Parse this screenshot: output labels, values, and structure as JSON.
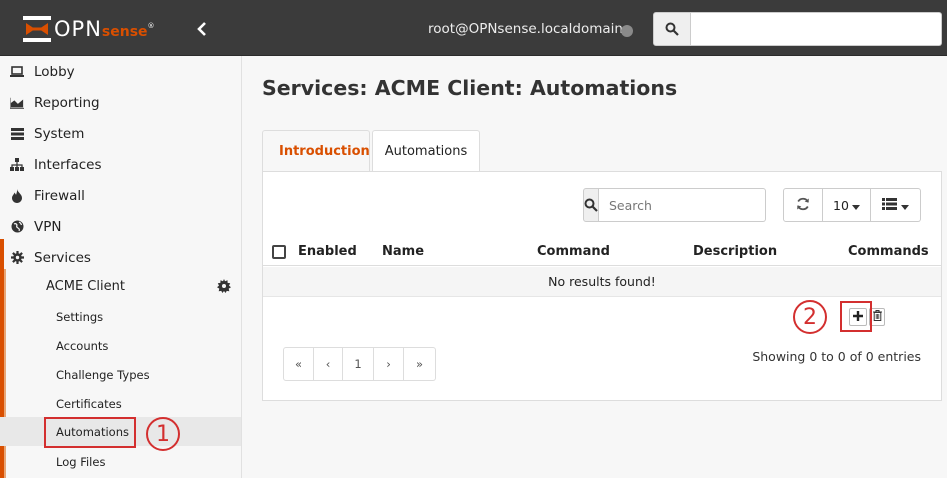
{
  "topbar": {
    "logo_text": "OPN",
    "logo_sense": "sense",
    "logo_reg": "®",
    "user": "root@OPNsense.localdomain"
  },
  "sidebar": {
    "items": [
      {
        "label": "Lobby",
        "icon": "laptop-icon"
      },
      {
        "label": "Reporting",
        "icon": "area-chart-icon"
      },
      {
        "label": "System",
        "icon": "server-icon"
      },
      {
        "label": "Interfaces",
        "icon": "sitemap-icon"
      },
      {
        "label": "Firewall",
        "icon": "fire-icon"
      },
      {
        "label": "VPN",
        "icon": "globe-icon"
      },
      {
        "label": "Services",
        "icon": "cog-icon"
      }
    ],
    "acme_label": "ACME Client",
    "sub_items": [
      {
        "label": "Settings"
      },
      {
        "label": "Accounts"
      },
      {
        "label": "Challenge Types"
      },
      {
        "label": "Certificates"
      },
      {
        "label": "Automations"
      },
      {
        "label": "Log Files"
      }
    ]
  },
  "main": {
    "title": "Services: ACME Client: Automations",
    "tabs": [
      {
        "label": "Introduction"
      },
      {
        "label": "Automations"
      }
    ],
    "search_placeholder": "Search",
    "rows_per_page": "10",
    "columns": [
      "Enabled",
      "Name",
      "Command",
      "Description",
      "Commands"
    ],
    "no_results": "No results found!",
    "pager": [
      "«",
      "‹",
      "1",
      "›",
      "»"
    ],
    "showing": "Showing 0 to 0 of 0 entries"
  },
  "annotations": {
    "step1": "1",
    "step2": "2"
  },
  "colors": {
    "brand": "#d94f00",
    "topbar": "#3b3b3b",
    "annotation": "#d32f2f"
  }
}
